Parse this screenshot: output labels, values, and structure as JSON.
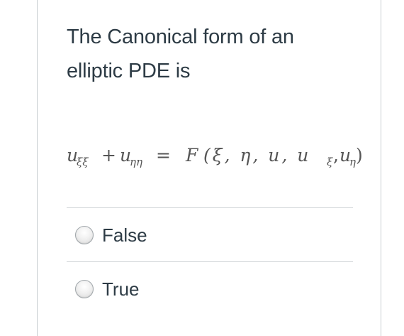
{
  "question": {
    "text": "The Canonical form of an elliptic PDE is"
  },
  "equation": {
    "term1_base": "u",
    "term1_sub": "ξξ",
    "plus": "+",
    "term2_base": "u",
    "term2_sub": "ηη",
    "equals": "=",
    "func": "F",
    "args": "(ξ, η, u, u",
    "arg4_sub": "ξ",
    "comma": ",",
    "arg5_base": "u",
    "arg5_sub": "η",
    "close": ")"
  },
  "answers": [
    {
      "label": "False",
      "selected": false
    },
    {
      "label": "True",
      "selected": false
    }
  ]
}
